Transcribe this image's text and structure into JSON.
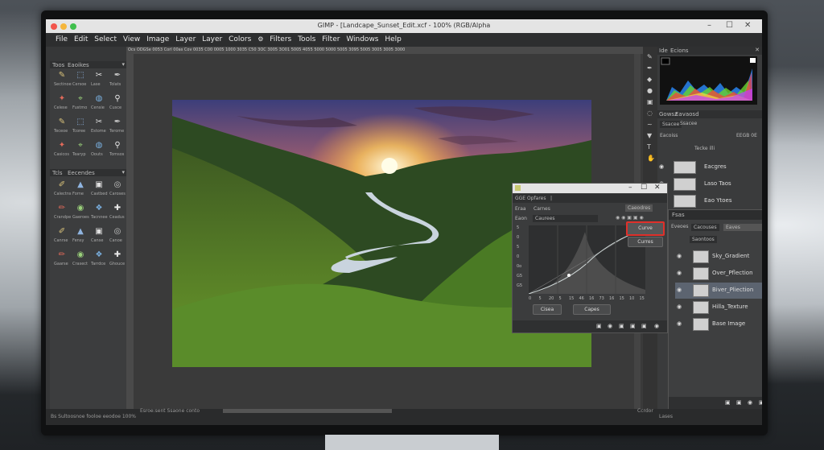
{
  "window": {
    "title": "GIMP - [Landcape_Sunset_Edit.xcf - 100% (RGB/Alpha",
    "controls": [
      "–",
      "☐",
      "✕"
    ]
  },
  "menu": [
    "File",
    "Edit",
    "Select",
    "View",
    "Image",
    "Layer",
    "Layer",
    "Colors",
    "Filters",
    "Tools",
    "Filter",
    "Windows",
    "Help"
  ],
  "menu_icon": "gear-icon",
  "toolbox": {
    "header": "Toos",
    "header2": "Eaoikes",
    "labels": [
      "Sectinoe",
      "Cersoe",
      "Lase",
      "Tolats",
      "Celese",
      "Fustmo",
      "Censie",
      "Cusce",
      "Teceoe",
      "Tcoree",
      "Estome",
      "Terome",
      "Casicos",
      "Tearyp",
      "Oouts",
      "Tomsos"
    ],
    "section2_title": "Tcls",
    "section2_label": "Eecendes",
    "labels2": [
      "Calectns",
      "Forne",
      "Castbed",
      "Caroses",
      "Crandpe",
      "Gaeroes",
      "Tacnnee",
      "Ceadus",
      "Canrse",
      "Fensy",
      "Canse",
      "Canoe",
      "Gaarse",
      "Crasect",
      "Tarrdce",
      "Ghouce"
    ]
  },
  "ruler_text": "Ocs   ODGSe  0053   Corl   00as   Cov  0035  C00   0005   1000  3035   C50  3OC   3005   3O01   5005  4055  5000   5000   5005  3095  5005  3005   3005  3000",
  "status": {
    "left": "Bs  Sultoosnoe fooloe  eeodoe  100%",
    "mid": "Esroe:sent  Ssaone conto",
    "right_a": "Ccrdor",
    "right_b": "Lases"
  },
  "histogram_panel": {
    "tab": "Ecions",
    "side": "Ide",
    "colors": [
      "#2a8cff",
      "#6ad32c",
      "#ff3a3a",
      "#f9f04a",
      "#c23bff"
    ]
  },
  "layers_panel_back": {
    "tab": "Eavaosd",
    "tab_left": "Gowsz",
    "title": "Ssacee",
    "mode": "Eacoiss",
    "mode_right": "EEGB 0E",
    "lock": "Tecke illi",
    "rows": [
      "Eacgres",
      "Laso Taos",
      "Eao Ytoes"
    ]
  },
  "curves_dialog": {
    "tab1": "GGE",
    "tab2": "Opfares",
    "channel_label": "Eraa",
    "channel_value": "Carnes",
    "right_label": "Caeodres",
    "preset_label": "Eaon",
    "preset_value": "Caurees",
    "highlighted_button": "Curve",
    "second_button": "Curres",
    "y_ticks": [
      "5",
      "0",
      "5",
      "0",
      "0o",
      "G5",
      "G5"
    ],
    "x_ticks": [
      "0",
      "5",
      "20",
      "5",
      "15",
      "46",
      "16",
      "73",
      "16",
      "15",
      "10",
      "15"
    ],
    "bottom_buttons": [
      "Cisea",
      "Capes"
    ]
  },
  "layers_panel": {
    "title": "Fsas",
    "mode_left": "Eveoes",
    "mode_mid": "Cacouses",
    "mode_right": "Eaves",
    "opacity": "Saontoos",
    "layers": [
      {
        "name": "Sky_Gradient",
        "selected": false
      },
      {
        "name": "Over_Pflection",
        "selected": false
      },
      {
        "name": "Biver_Pliection",
        "selected": true
      },
      {
        "name": "Hilla_Texture",
        "selected": false
      },
      {
        "name": "Base Image",
        "selected": false
      }
    ]
  },
  "docked_icons": [
    "brush-icon",
    "pen-icon",
    "shapes-icon",
    "drop-icon",
    "stamp-icon",
    "eraser-icon",
    "smudge-icon",
    "fill-icon",
    "text-icon",
    "hand-icon"
  ]
}
